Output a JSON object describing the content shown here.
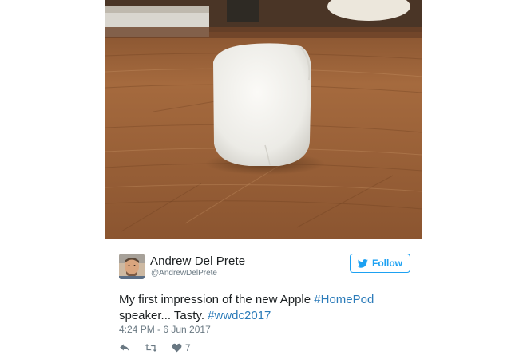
{
  "tweet": {
    "author": {
      "name": "Andrew Del Prete",
      "handle": "@AndrewDelPrete"
    },
    "follow_label": "Follow",
    "text": {
      "part1": "My first impression of the new Apple ",
      "hashtag1": "#HomePod",
      "part2": " speaker... Tasty. ",
      "hashtag2": "#wwdc2017"
    },
    "timestamp": "4:24 PM - 6 Jun 2017",
    "like_count": "7"
  },
  "icons": {
    "follow": "twitter-bird-icon",
    "reply": "reply-icon",
    "retweet": "retweet-icon",
    "like": "heart-icon"
  },
  "colors": {
    "accent": "#1da1f2",
    "hashtag": "#2b7bb9",
    "text": "#1c2022",
    "muted": "#697882"
  }
}
